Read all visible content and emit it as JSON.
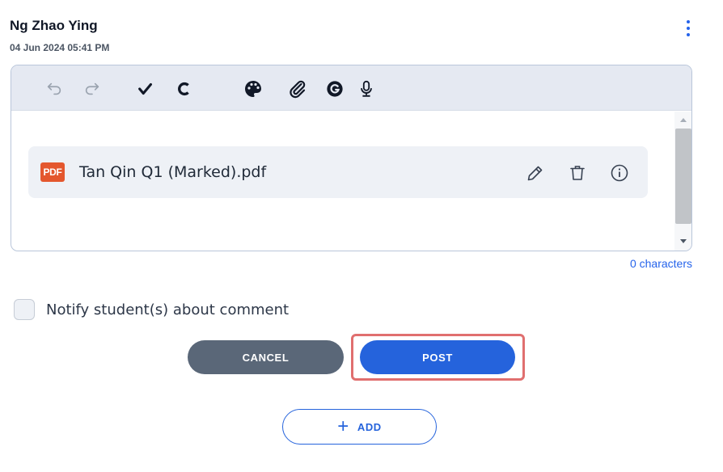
{
  "comment": {
    "author": "Ng Zhao Ying",
    "timestamp": "04 Jun 2024 05:41 PM"
  },
  "toolbar": {
    "icons": [
      "undo-icon",
      "redo-icon",
      "checkmark-icon",
      "c-icon",
      "palette-icon",
      "paperclip-icon",
      "grammarly-icon",
      "microphone-icon"
    ]
  },
  "attachment": {
    "badge": "PDF",
    "file_name": "Tan Qin Q1 (Marked).pdf",
    "actions": [
      "pencil-icon",
      "trash-icon",
      "info-icon"
    ]
  },
  "editor": {
    "char_count": "0 characters"
  },
  "notify": {
    "label": "Notify student(s) about comment",
    "checked": false
  },
  "actions": {
    "cancel_label": "CANCEL",
    "post_label": "POST",
    "add_label": "ADD"
  },
  "colors": {
    "accent": "#2563dc",
    "cancel": "#5a6778",
    "highlight": "#e06f6f",
    "pdf": "#e4572e"
  }
}
